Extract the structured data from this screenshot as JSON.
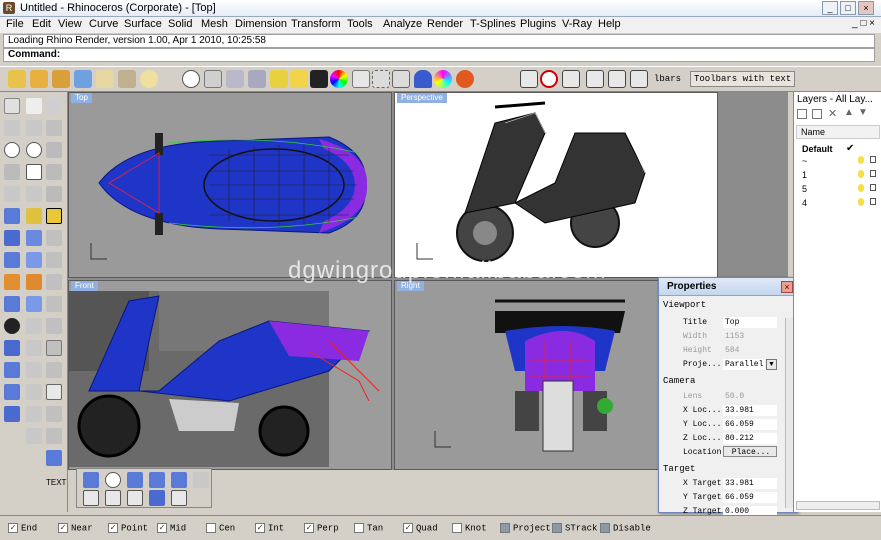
{
  "window": {
    "title": "Untitled - Rhinoceros (Corporate) - [Top]",
    "minimize": "_",
    "restore": "□",
    "close": "×"
  },
  "menu": [
    "File",
    "Edit",
    "View",
    "Curve",
    "Surface",
    "Solid",
    "Mesh",
    "Dimension",
    "Transform",
    "Tools",
    "Analyze",
    "Render",
    "T-Splines",
    "Plugins",
    "V-Ray",
    "Help"
  ],
  "command": {
    "history": "Loading Rhino Render, version 1.00, Apr  1 2010, 10:25:58",
    "prompt": "Command:"
  },
  "toolbar": {
    "label_bars": "lbars",
    "label_text": "Toolbars with text"
  },
  "viewports": {
    "top": "Top",
    "perspective": "Perspective",
    "front": "Front",
    "right": "Right"
  },
  "watermark": "dgwingroup.en.alibaba.com",
  "properties": {
    "title": "Properties",
    "viewport_header": "Viewport",
    "rows": [
      {
        "label": "Title",
        "value": "Top"
      },
      {
        "label": "Width",
        "value": "1153"
      },
      {
        "label": "Height",
        "value": "584"
      },
      {
        "label": "Proje...",
        "value": "Parallel"
      }
    ],
    "camera_header": "Camera",
    "camera": [
      {
        "label": "Lens",
        "value": "50.0"
      },
      {
        "label": "X Loc...",
        "value": "33.981"
      },
      {
        "label": "Y Loc...",
        "value": "66.059"
      },
      {
        "label": "Z Loc...",
        "value": "80.212"
      },
      {
        "label": "Location",
        "value": "Place..."
      }
    ],
    "target_header": "Target",
    "target": [
      {
        "label": "X Target",
        "value": "33.981"
      },
      {
        "label": "Y Target",
        "value": "66.059"
      },
      {
        "label": "Z Target",
        "value": "0.000"
      }
    ]
  },
  "layers": {
    "title": "Layers - All Lay...",
    "column": "Name",
    "rows": [
      {
        "name": "Default",
        "current": "✔"
      },
      {
        "name": "~"
      },
      {
        "name": "1"
      },
      {
        "name": "5"
      },
      {
        "name": "4"
      }
    ]
  },
  "left_panel": {
    "text_label": "TEXT"
  },
  "osnaps": [
    {
      "label": "End",
      "checked": true
    },
    {
      "label": "Near",
      "checked": true
    },
    {
      "label": "Point",
      "checked": true
    },
    {
      "label": "Mid",
      "checked": true
    },
    {
      "label": "Cen",
      "checked": false
    },
    {
      "label": "Int",
      "checked": true
    },
    {
      "label": "Perp",
      "checked": true
    },
    {
      "label": "Tan",
      "checked": false
    },
    {
      "label": "Quad",
      "checked": true
    },
    {
      "label": "Knot",
      "checked": false
    },
    {
      "label": "Project",
      "checked": false
    },
    {
      "label": "STrack",
      "checked": false
    },
    {
      "label": "Disable",
      "checked": false
    }
  ],
  "colors": {
    "accent": "#8fb0e0",
    "model_blue": "#1f35c8",
    "model_purple": "#8a2be2"
  }
}
